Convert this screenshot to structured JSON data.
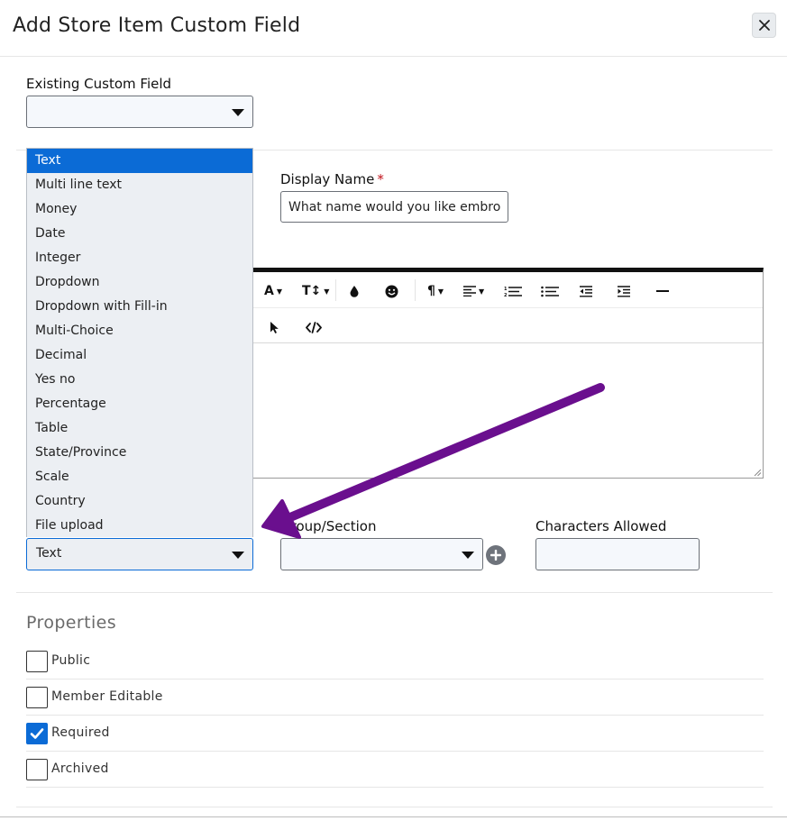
{
  "dialog": {
    "title": "Add Store Item Custom Field",
    "close_label": "×"
  },
  "existing_field": {
    "label": "Existing Custom Field",
    "value": ""
  },
  "display_name": {
    "label": "Display Name",
    "required_mark": "*",
    "value": "What name would you like embro"
  },
  "field_type": {
    "options": [
      "Text",
      "Multi line text",
      "Money",
      "Date",
      "Integer",
      "Dropdown",
      "Dropdown with Fill-in",
      "Multi-Choice",
      "Decimal",
      "Yes no",
      "Percentage",
      "Table",
      "State/Province",
      "Scale",
      "Country",
      "File upload"
    ],
    "selected": "Text"
  },
  "group_section": {
    "label": "Group/Section",
    "value": ""
  },
  "characters_allowed": {
    "label": "Characters Allowed",
    "value": ""
  },
  "editor": {
    "toolbar_icons": [
      "font-color-icon",
      "font-size-icon",
      "ink-drop-icon",
      "emoji-icon",
      "paragraph-icon",
      "align-left-icon",
      "ordered-list-icon",
      "unordered-list-icon",
      "outdent-icon",
      "indent-icon",
      "horizontal-rule-icon",
      "cursor-select-icon",
      "code-view-icon"
    ],
    "tb_font": "A",
    "tb_size": "T↕",
    "tb_para": "¶",
    "tb_dd": "▼"
  },
  "properties": {
    "title": "Properties",
    "items": [
      {
        "label": "Public",
        "checked": false
      },
      {
        "label": "Member Editable",
        "checked": false
      },
      {
        "label": "Required",
        "checked": true
      },
      {
        "label": "Archived",
        "checked": false
      }
    ]
  },
  "colors": {
    "accent": "#0b6bd6",
    "annotation_arrow": "#6a0f8e",
    "required": "#c0121a"
  }
}
